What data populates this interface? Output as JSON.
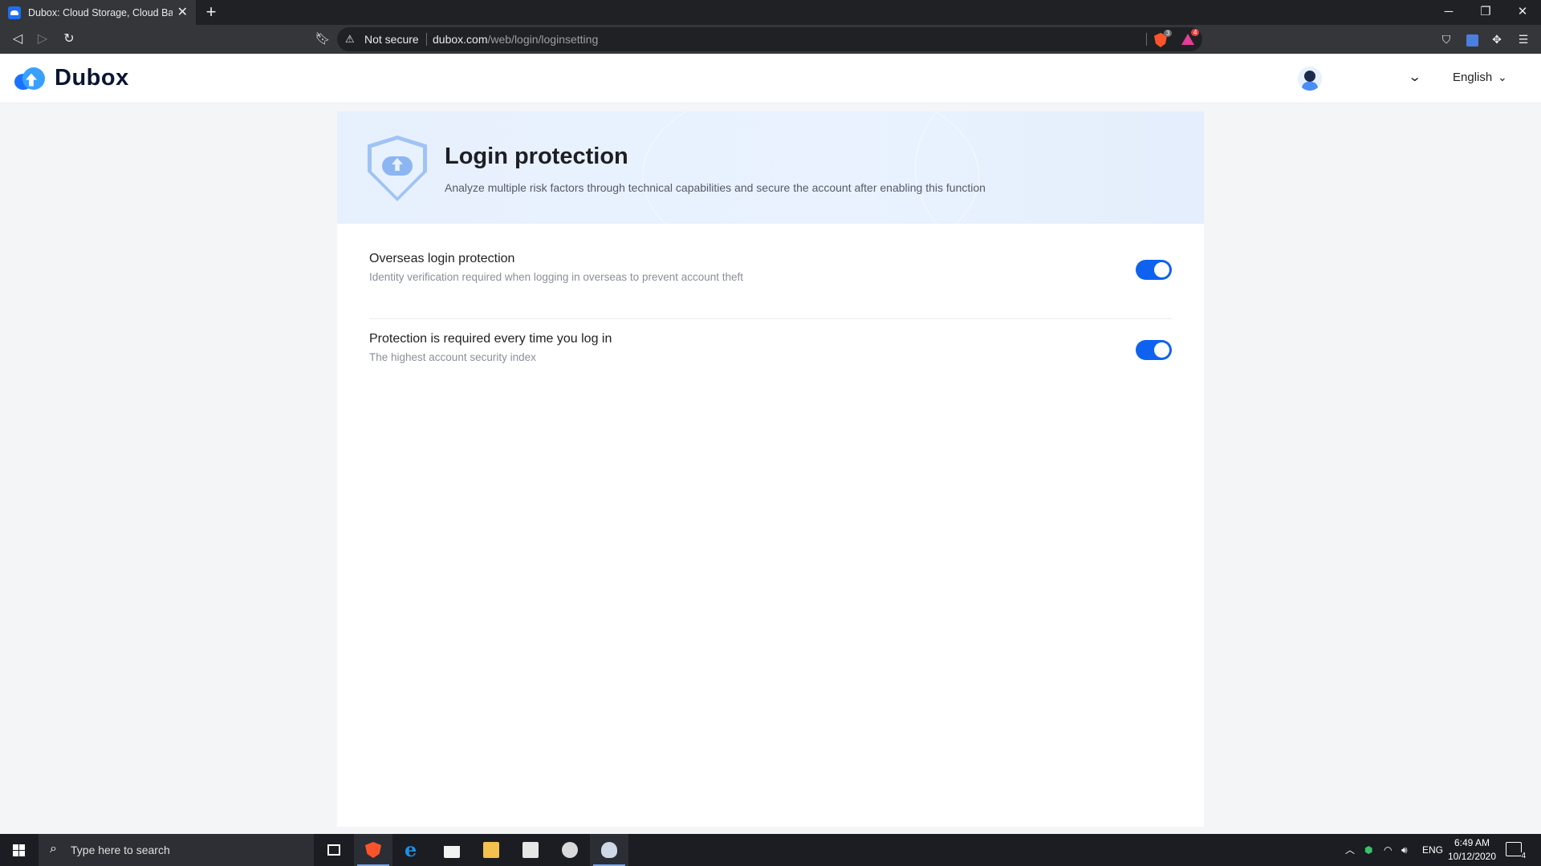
{
  "browser": {
    "tab_title": "Dubox: Cloud Storage, Cloud Back",
    "new_tab_symbol": "+",
    "not_secure_label": "Not secure",
    "url_host": "dubox.com",
    "url_path": "/web/login/loginsetting",
    "brave_shield_count": "3",
    "rewards_count": "4"
  },
  "header": {
    "logo_text": "Dubox",
    "language": "English"
  },
  "banner": {
    "title": "Login protection",
    "description": "Analyze multiple risk factors through technical capabilities and secure the account after enabling this function"
  },
  "settings": [
    {
      "label": "Overseas login protection",
      "description": "Identity verification required when logging in overseas to prevent account theft",
      "enabled": true
    },
    {
      "label": "Protection is required every time you log in",
      "description": "The highest account security index",
      "enabled": true
    }
  ],
  "taskbar": {
    "search_placeholder": "Type here to search",
    "language_indicator": "ENG",
    "time": "6:49 AM",
    "date": "10/12/2020",
    "notification_count": "4"
  },
  "colors": {
    "accent": "#0f62f0",
    "banner_bg": "#e7f0fd",
    "page_bg": "#f4f5f7"
  }
}
